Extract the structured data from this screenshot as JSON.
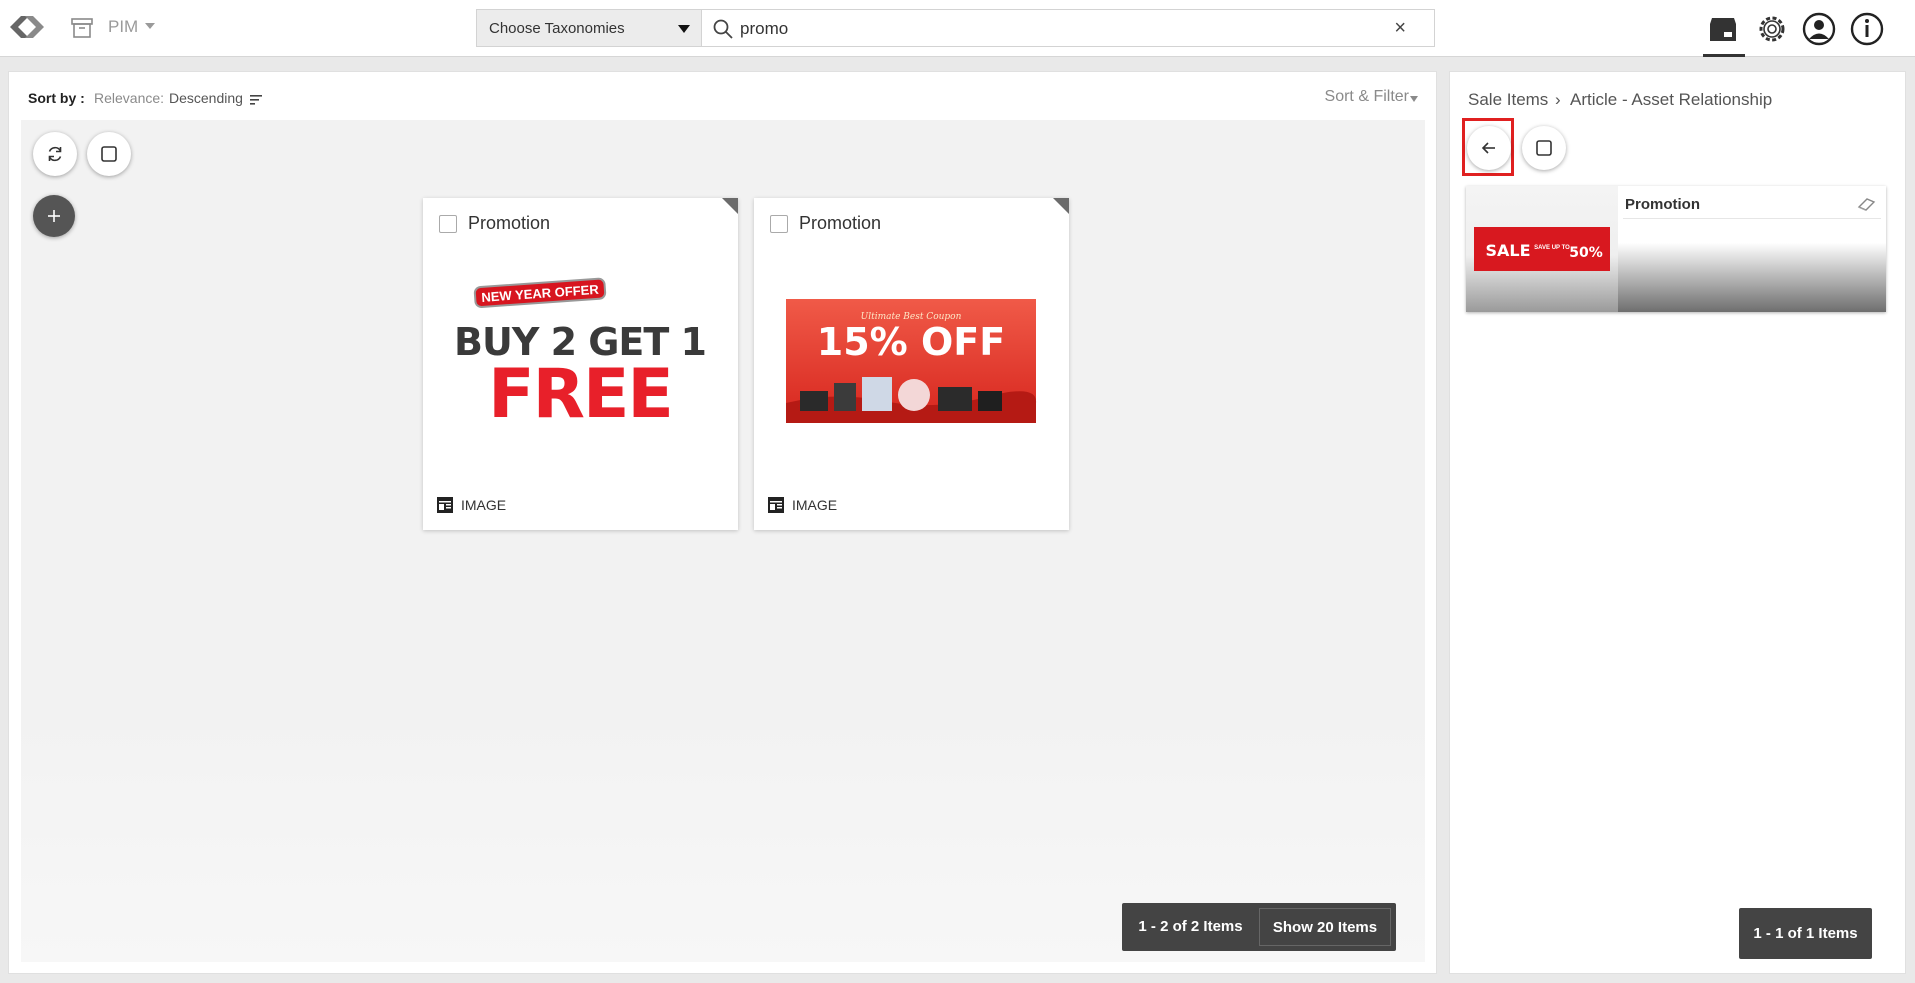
{
  "topbar": {
    "app_label": "PIM",
    "taxonomy_select": "Choose Taxonomies",
    "search_value": "promo",
    "clear_symbol": "×"
  },
  "main": {
    "sort_by_label": "Sort by :",
    "relevance_label": "Relevance:",
    "sort_order": "Descending",
    "sort_filter_label": "Sort & Filter",
    "cards": [
      {
        "title": "Promotion",
        "type": "IMAGE",
        "image": {
          "badge": "NEW YEAR OFFER",
          "line1": "BUY 2 GET 1",
          "line2": "FREE"
        }
      },
      {
        "title": "Promotion",
        "type": "IMAGE",
        "image": {
          "kicker": "Ultimate Best Coupon",
          "headline": "15% OFF"
        }
      }
    ],
    "pager": {
      "range": "1 - 2 of 2 Items",
      "show": "Show 20 Items"
    }
  },
  "side": {
    "breadcrumb": [
      "Sale Items",
      "Article - Asset Relationship"
    ],
    "breadcrumb_sep": "›",
    "related": {
      "title": "Promotion",
      "image": {
        "sale": "SALE",
        "save": "SAVE UP TO",
        "pct": "50%"
      }
    },
    "pager": {
      "range": "1 - 1 of 1 Items"
    }
  },
  "colors": {
    "accent_red": "#e02020",
    "dark": "#444444",
    "promo_red": "#e8202a"
  }
}
